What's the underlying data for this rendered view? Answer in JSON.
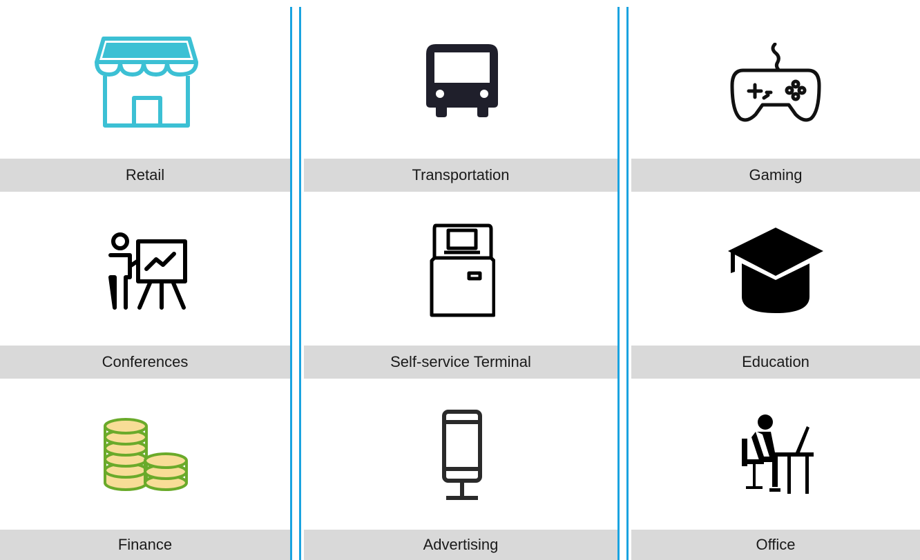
{
  "accent_color": "#1aa3e0",
  "label_bar_color": "#d9d9d9",
  "tiles": [
    {
      "label": "Retail",
      "icon": "storefront-icon"
    },
    {
      "label": "Transportation",
      "icon": "bus-icon"
    },
    {
      "label": "Gaming",
      "icon": "gamepad-icon"
    },
    {
      "label": "Conferences",
      "icon": "presentation-icon"
    },
    {
      "label": "Self-service Terminal",
      "icon": "kiosk-icon"
    },
    {
      "label": "Education",
      "icon": "graduation-cap-icon"
    },
    {
      "label": "Finance",
      "icon": "coin-stack-icon"
    },
    {
      "label": "Advertising",
      "icon": "signage-stand-icon"
    },
    {
      "label": "Office",
      "icon": "person-at-desk-icon"
    }
  ]
}
